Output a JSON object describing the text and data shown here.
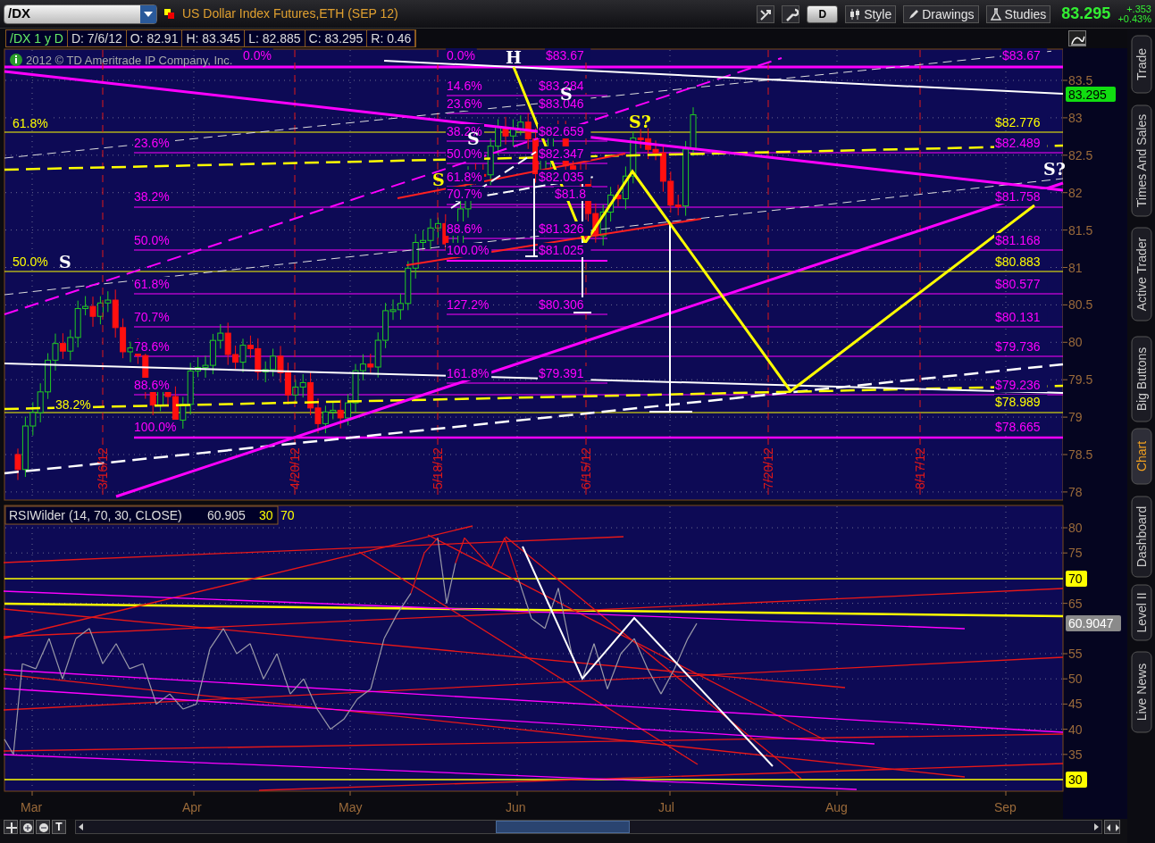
{
  "toolbar": {
    "symbol": "/DX",
    "title": "US Dollar Index Futures,ETH (SEP 12)",
    "buttons": [
      {
        "kind": "period",
        "label": "D"
      },
      {
        "kind": "style",
        "label": "Style"
      },
      {
        "kind": "drawings",
        "label": "Drawings"
      },
      {
        "kind": "studies",
        "label": "Studies"
      }
    ],
    "last_price": "83.295",
    "change": "+.353",
    "change_percent": "+0.43%"
  },
  "info_bar": [
    "/DX 1 y D",
    "D: 7/6/12",
    "O: 82.91",
    "H: 83.345",
    "L: 82.885",
    "C: 83.295",
    "R: 0.46"
  ],
  "price_panel": {
    "copyright": "2012 © TD Ameritrade IP Company, Inc.",
    "y_axis": [
      "83.5",
      "83",
      "82.5",
      "82",
      "81.5",
      "81",
      "80.5",
      "80",
      "79.5",
      "79",
      "78.5",
      "78"
    ],
    "price_label": "83.295",
    "date_markers": [
      "3/16/12",
      "4/20/12",
      "5/18/12",
      "6/15/12",
      "7/20/12",
      "8/17/12"
    ],
    "labels": [
      {
        "text": "0.0%",
        "color": "#ff00ff"
      },
      {
        "text": "61.8%",
        "color": "#ffff00"
      },
      {
        "text": "23.6%",
        "color": "#ff00ff"
      },
      {
        "text": "38.2%",
        "color": "#ff00ff"
      },
      {
        "text": "50.0%",
        "color": "#ffff00"
      },
      {
        "text": "50.0%",
        "color": "#ff00ff"
      },
      {
        "text": "61.8%",
        "color": "#ff00ff"
      },
      {
        "text": "70.7%",
        "color": "#ff00ff"
      },
      {
        "text": "78.6%",
        "color": "#ff00ff"
      },
      {
        "text": "88.6%",
        "color": "#ff00ff"
      },
      {
        "text": "38.2%",
        "color": "#ffff00"
      },
      {
        "text": "100.0%",
        "color": "#ff00ff"
      },
      {
        "text": "0.0%",
        "color": "#ff00ff"
      },
      {
        "text": "14.6%",
        "color": "#ff00ff"
      },
      {
        "text": "23.6%",
        "color": "#ff00ff"
      },
      {
        "text": "38.2%",
        "color": "#ff00ff"
      },
      {
        "text": "50.0%",
        "color": "#ff00ff"
      },
      {
        "text": "61.8%",
        "color": "#ff00ff"
      },
      {
        "text": "70.7%",
        "color": "#ff00ff"
      },
      {
        "text": "88.6%",
        "color": "#ff00ff"
      },
      {
        "text": "100.0%",
        "color": "#ff00ff"
      },
      {
        "text": "127.2%",
        "color": "#ff00ff"
      },
      {
        "text": "161.8%",
        "color": "#ff00ff"
      },
      {
        "text": "$83.67",
        "color": "#ff00ff"
      },
      {
        "text": "$83.284",
        "color": "#ff00ff"
      },
      {
        "text": "$83.046",
        "color": "#ff00ff"
      },
      {
        "text": "$82.659",
        "color": "#ff00ff"
      },
      {
        "text": "$82.347",
        "color": "#ff00ff"
      },
      {
        "text": "$82.035",
        "color": "#ff00ff"
      },
      {
        "text": "$81.8",
        "color": "#ff00ff"
      },
      {
        "text": "$81.326",
        "color": "#ff00ff"
      },
      {
        "text": "$81.025",
        "color": "#ff00ff"
      },
      {
        "text": "$80.306",
        "color": "#ff00ff"
      },
      {
        "text": "$79.391",
        "color": "#ff00ff"
      },
      {
        "text": "$83.67",
        "color": "#ff00ff"
      },
      {
        "text": "$82.776",
        "color": "#ffff00"
      },
      {
        "text": "$82.489",
        "color": "#ff00ff"
      },
      {
        "text": "$81.758",
        "color": "#ff00ff"
      },
      {
        "text": "$81.168",
        "color": "#ff00ff"
      },
      {
        "text": "$80.883",
        "color": "#ffff00"
      },
      {
        "text": "$80.577",
        "color": "#ff00ff"
      },
      {
        "text": "$80.131",
        "color": "#ff00ff"
      },
      {
        "text": "$79.736",
        "color": "#ff00ff"
      },
      {
        "text": "$79.236",
        "color": "#ff00ff"
      },
      {
        "text": "$78.989",
        "color": "#ffff00"
      },
      {
        "text": "$78.665",
        "color": "#ff00ff"
      }
    ],
    "wave_labels": [
      {
        "text": "H",
        "color": "#ffffff"
      },
      {
        "text": "S",
        "color": "#ffffff"
      },
      {
        "text": "S",
        "color": "#ffffff"
      },
      {
        "text": "S",
        "color": "#ffff00"
      },
      {
        "text": "S?",
        "color": "#ffff00"
      },
      {
        "text": "S",
        "color": "#ffffff"
      },
      {
        "text": "S?",
        "color": "#ffffff"
      }
    ]
  },
  "rsi_panel": {
    "study": "RSIWilder (14, 70, 30, CLOSE)",
    "value": "60.905",
    "levels": [
      "30",
      "70"
    ],
    "y_axis": [
      "80",
      "75",
      "65",
      "55",
      "50",
      "45",
      "40",
      "35"
    ],
    "markers": [
      {
        "kind": "level",
        "text": "70"
      },
      {
        "kind": "current",
        "text": "60.9047"
      },
      {
        "kind": "level",
        "text": "30"
      }
    ]
  },
  "time_axis": [
    "Mar",
    "Apr",
    "May",
    "Jun",
    "Jul",
    "Aug",
    "Sep"
  ],
  "scroll_bar": {
    "text_tool": "T"
  },
  "side_tabs": [
    {
      "label": "Trade",
      "selected": false
    },
    {
      "label": "Times And Sales",
      "selected": false
    },
    {
      "label": "Active Trader",
      "selected": false
    },
    {
      "label": "Big Buttons",
      "selected": false
    },
    {
      "label": "Chart",
      "selected": true
    },
    {
      "label": "Dashboard",
      "selected": false
    },
    {
      "label": "Level II",
      "selected": false
    },
    {
      "label": "Live News",
      "selected": false
    }
  ]
}
